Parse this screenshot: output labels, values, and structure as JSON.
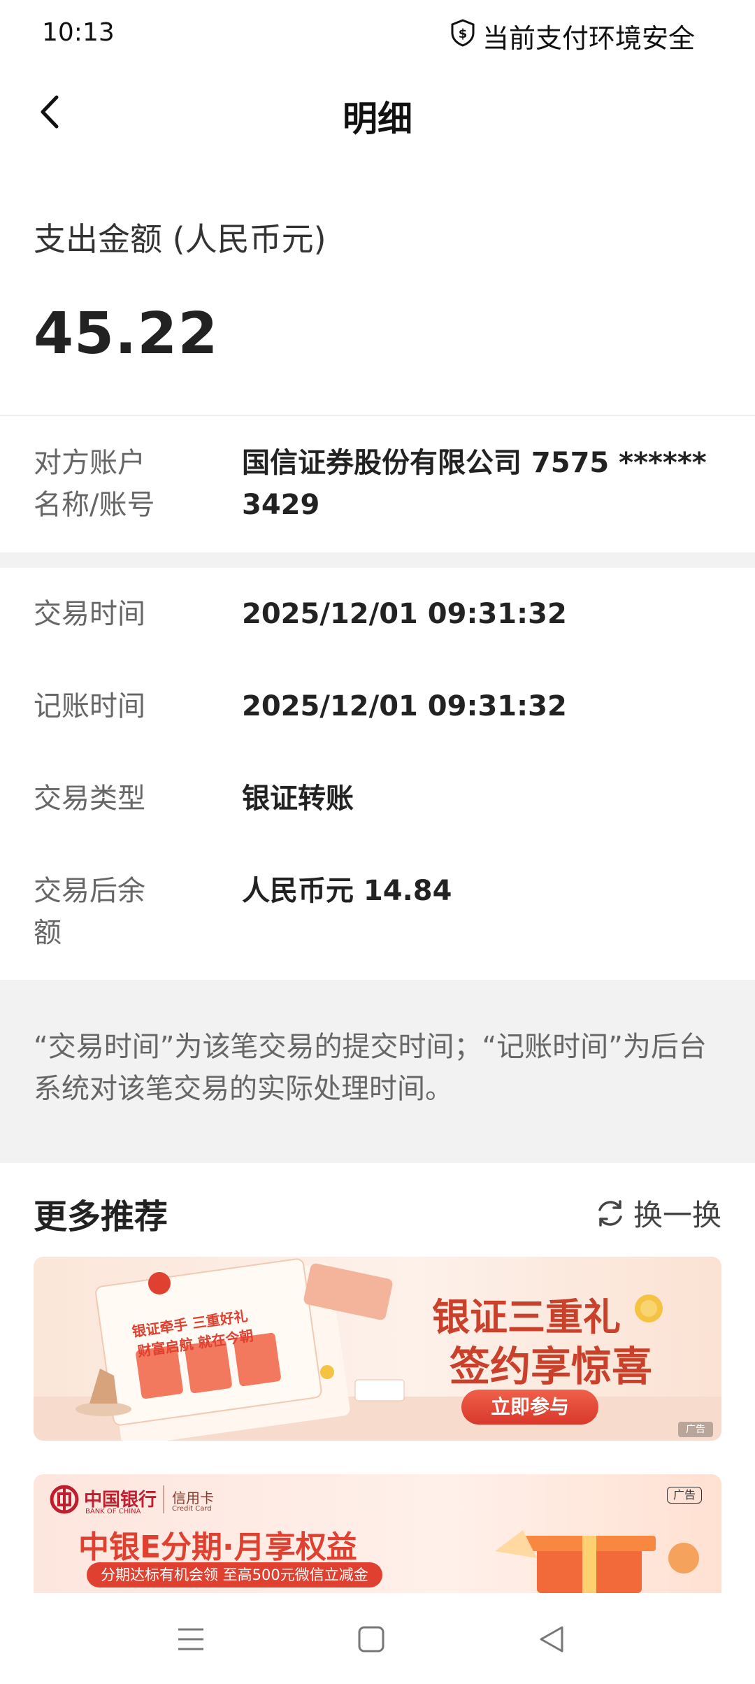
{
  "status_bar": {
    "time": "10:13",
    "security_text": "当前支付环境安全",
    "security_icon": "shield-dollar-icon"
  },
  "nav": {
    "title": "明细",
    "back_icon": "chevron-left-icon"
  },
  "amount": {
    "label": "支出金额 (人民币元)",
    "value": "45.22"
  },
  "counterparty": {
    "label_line1": "对方账户",
    "label_line2": "名称/账号",
    "value_line1": "国信证券股份有限公司 7575 ******",
    "value_line2": "3429"
  },
  "details": [
    {
      "label": "交易时间",
      "value": "2025/12/01 09:31:32"
    },
    {
      "label": "记账时间",
      "value": "2025/12/01 09:31:32"
    },
    {
      "label": "交易类型",
      "value": "银证转账"
    },
    {
      "label_line1": "交易后余",
      "label_line2": "额",
      "value": "人民币元 14.84"
    }
  ],
  "note": {
    "line1": "“交易时间”为该笔交易的提交时间；“记账时间”为后台",
    "line2": "系统对该笔交易的实际处理时间。"
  },
  "more": {
    "title": "更多推荐",
    "refresh_label": "换一换",
    "refresh_icon": "refresh-icon"
  },
  "banner1": {
    "headline1": "银证三重礼",
    "headline2": "签约享惊喜",
    "cta": "立即参与",
    "ad_tag": "广告",
    "paper_text1": "银证牵手 三重好礼",
    "paper_text2": "财富启航 就在今朝"
  },
  "banner2": {
    "bank_name": "中国银行",
    "bank_name_en": "BANK OF CHINA",
    "card_type": "信用卡",
    "card_type_en": "Credit Card",
    "ad_tag": "广告",
    "headline": "中银E分期·月享权益",
    "sub": "分期达标有机会领 至高500元微信立减金"
  },
  "colors": {
    "accent_red": "#e0402f",
    "banner_red": "#c9412a",
    "text_dark": "#222222",
    "text_gray": "#666666",
    "band_gray": "#f2f2f2"
  }
}
